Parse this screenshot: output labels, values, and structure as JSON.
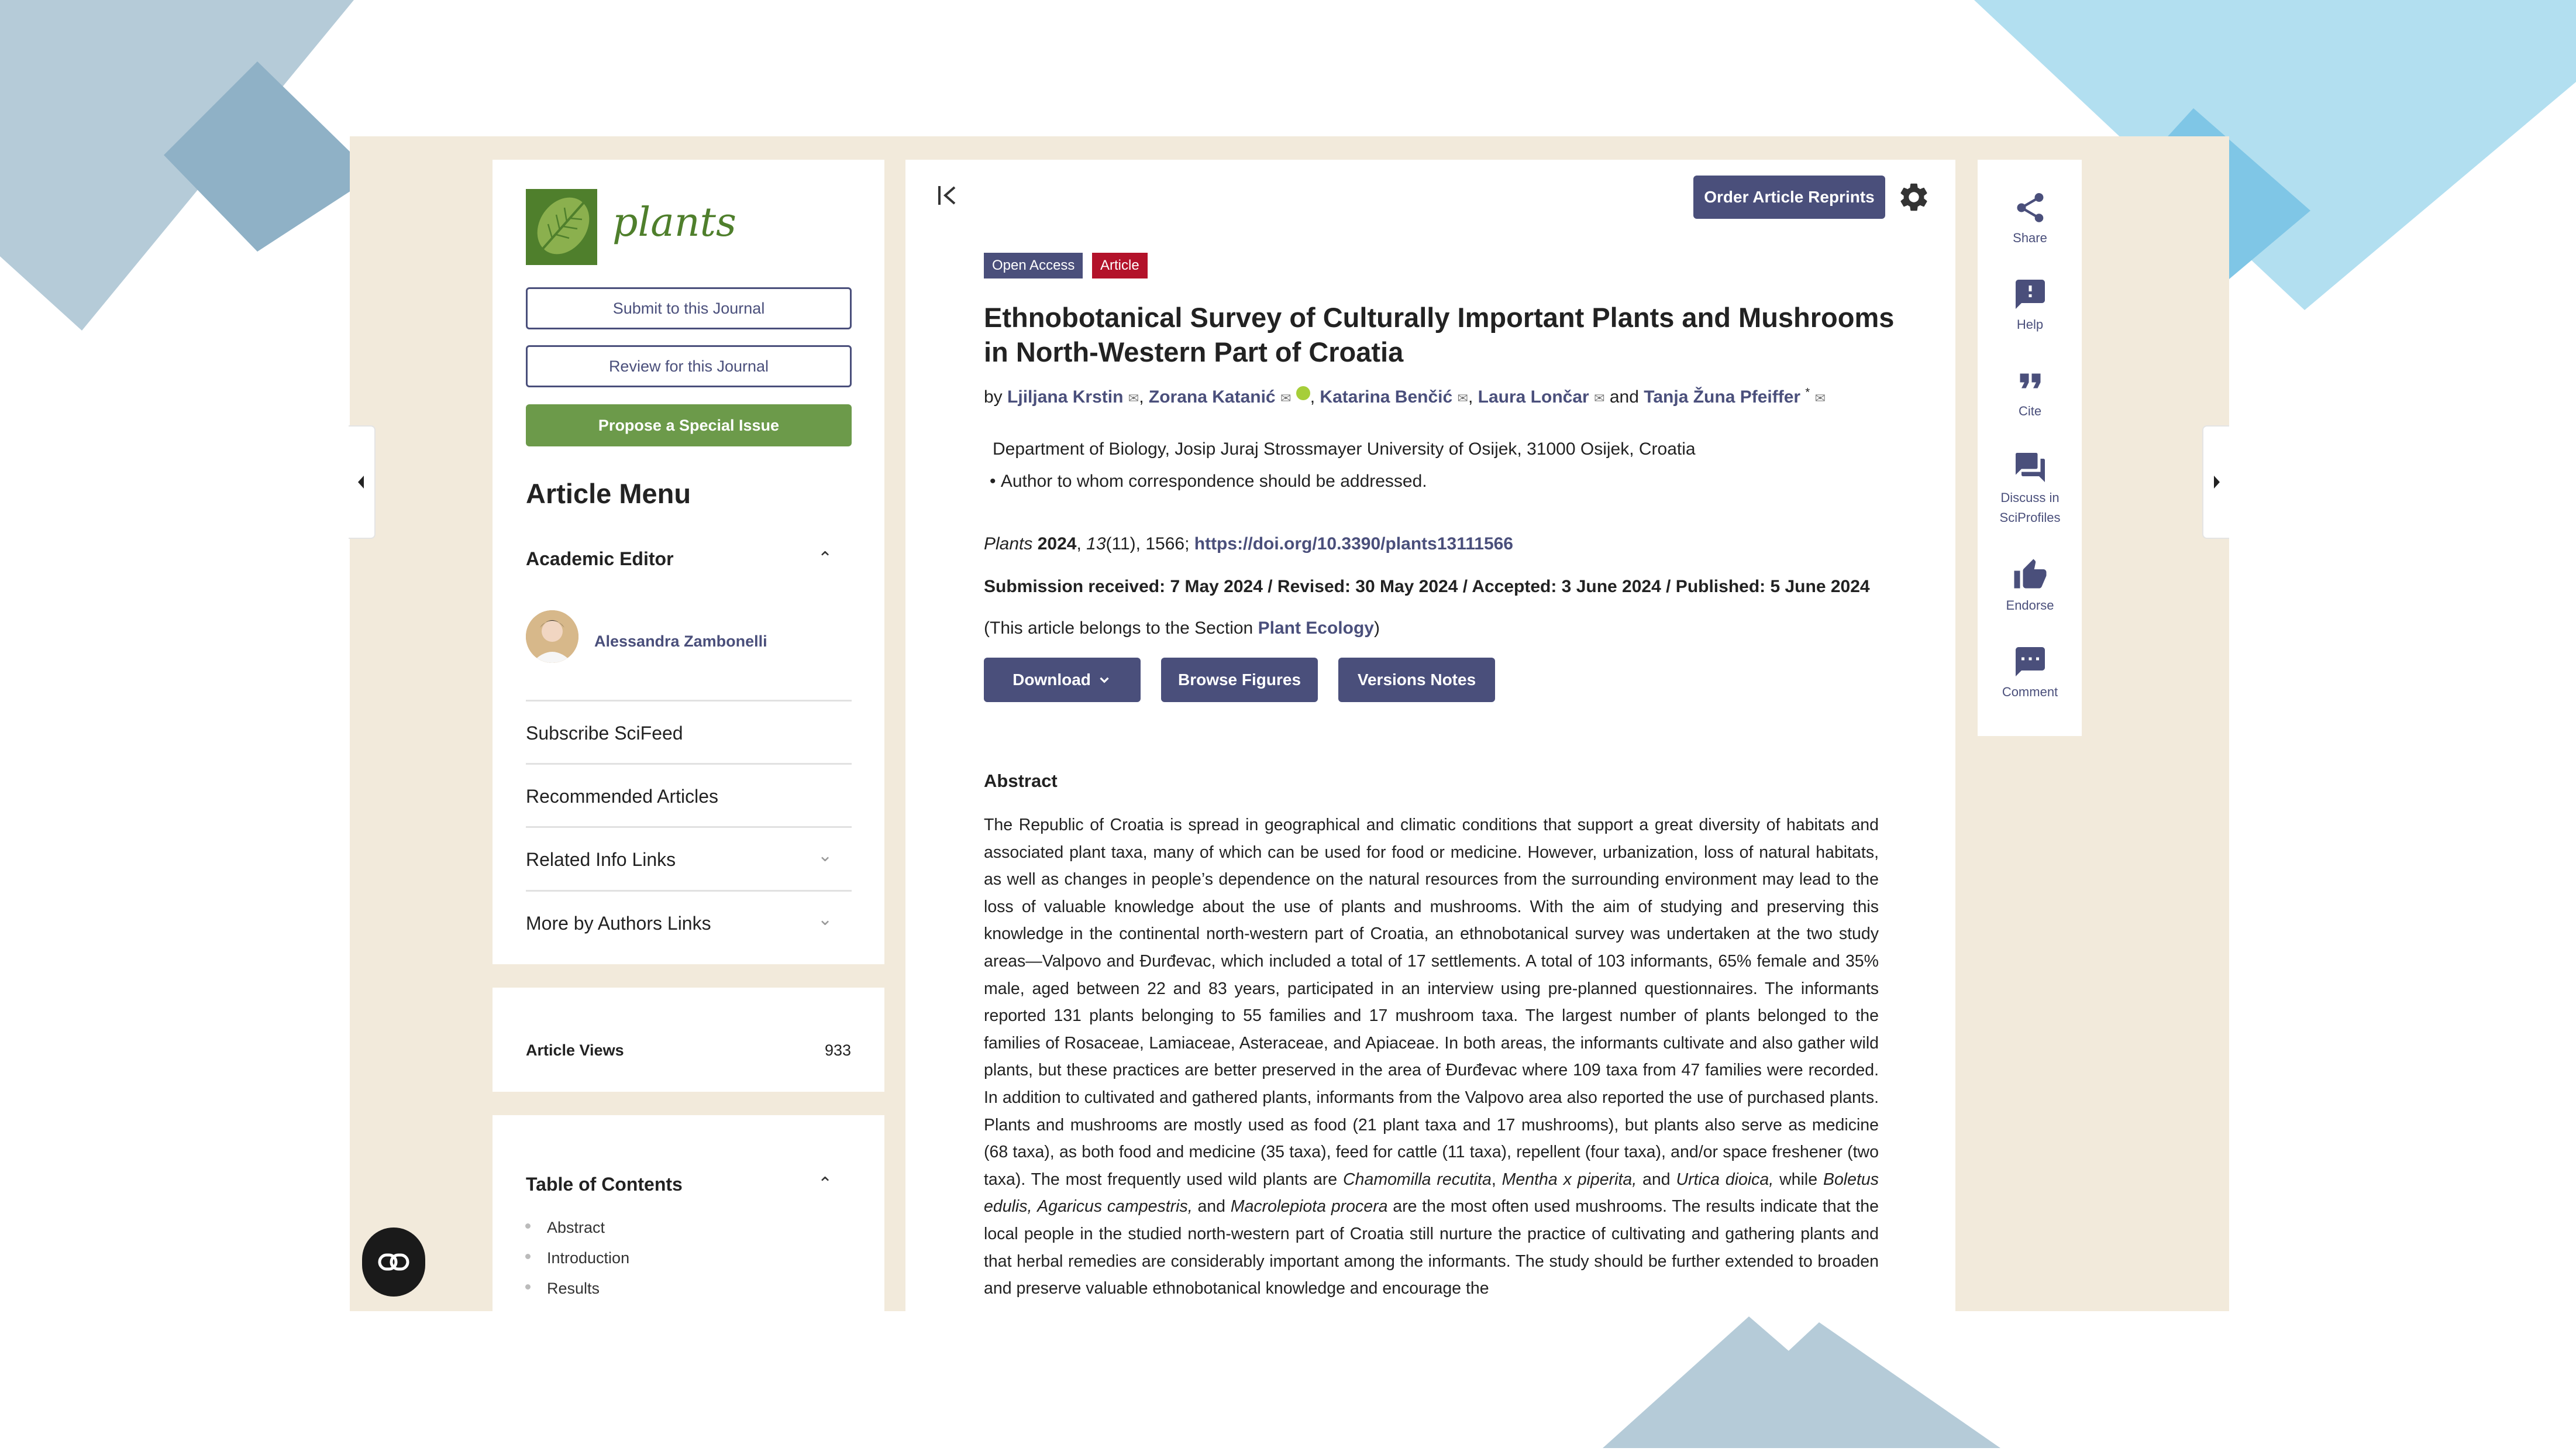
{
  "journal": {
    "name": "plants"
  },
  "sidebar": {
    "submit_label": "Submit to this Journal",
    "review_label": "Review for this Journal",
    "propose_label": "Propose a Special Issue",
    "menu_title": "Article Menu",
    "academic_editor_title": "Academic Editor",
    "editor_name": "Alessandra Zambonelli",
    "items": [
      {
        "label": "Subscribe SciFeed"
      },
      {
        "label": "Recommended Articles"
      },
      {
        "label": "Related Info Links"
      },
      {
        "label": "More by Authors Links"
      }
    ],
    "article_views_label": "Article Views",
    "article_views_count": "933",
    "toc_title": "Table of Contents",
    "toc_items": [
      "Abstract",
      "Introduction",
      "Results"
    ]
  },
  "toolbar": {
    "order_reprints_label": "Order Article Reprints"
  },
  "article": {
    "badge_open_access": "Open Access",
    "badge_article": "Article",
    "title_line1": "Ethnobotanical Survey of Culturally Important Plants and Mushrooms",
    "title_line2": "in North-Western Part of Croatia",
    "by": "by",
    "authors": [
      "Ljiljana Krstin",
      "Zorana Katanić",
      "Katarina Benčić",
      "Laura Lončar",
      "Tanja Žuna Pfeiffer"
    ],
    "author_sep": ",",
    "and": "and",
    "asterisk": "*",
    "affiliation": "Department of Biology, Josip Juraj Strossmayer University of Osijek, 31000 Osijek, Croatia",
    "correspondence": "Author to whom correspondence should be addressed.",
    "citation_journal": "Plants",
    "citation_year": "2024",
    "citation_volume": "13",
    "citation_rest": "(11), 1566;",
    "doi": "https://doi.org/10.3390/plants13111566",
    "dates": "Submission received: 7 May 2024 / Revised: 30 May 2024 / Accepted: 3 June 2024 / Published: 5 June 2024",
    "section_prefix": "(This article belongs to the Section",
    "section_name": "Plant Ecology",
    "section_suffix": ")",
    "download_label": "Download",
    "browse_figures_label": "Browse Figures",
    "versions_notes_label": "Versions Notes",
    "abstract_heading": "Abstract",
    "abstract_part1": "The Republic of Croatia is spread in geographical and climatic conditions that support a great diversity of habitats and associated plant taxa, many of which can be used for food or medicine. However, urbanization, loss of natural habitats, as well as changes in people’s dependence on the natural resources from the surrounding environment may lead to the loss of valuable knowledge about the use of plants and mushrooms. With the aim of studying and preserving this knowledge in the continental north-western part of Croatia, an ethnobotanical survey was undertaken at the two study areas—Valpovo and Đurđevac, which included a total of 17 settlements. A total of 103 informants, 65% female and 35% male, aged between 22 and 83 years, participated in an interview using pre-planned questionnaires. The informants reported 131 plants belonging to 55 families and 17 mushroom taxa. The largest number of plants belonged to the families of Rosaceae, Lamiaceae, Asteraceae, and Apiaceae. In both areas, the informants cultivate and also gather wild plants, but these practices are better preserved in the area of Đurđevac where 109 taxa from 47 families were recorded. In addition to cultivated and gathered plants, informants from the Valpovo area also reported the use of purchased plants. Plants and mushrooms are mostly used as food (21 plant taxa and 17 mushrooms), but plants also serve as medicine (68 taxa), as both food and medicine (35 taxa), feed for cattle (11 taxa), repellent (four taxa), and/or space freshener (two taxa). The most frequently used wild plants are",
    "species_1": "Chamomilla recutita",
    "species_2": "Mentha x piperita,",
    "conj_and": "and",
    "species_3": "Urtica dioica,",
    "conj_while": "while",
    "species_4": "Boletus edulis,",
    "species_5": "Agaricus campestris,",
    "species_6": "Macrolepiota procera",
    "abstract_part2": "are the most often used mushrooms. The results indicate that the local people in the studied north-western part of Croatia still nurture the practice of cultivating and gathering plants and that herbal remedies are considerably important among the informants. The study should be further extended to broaden and preserve valuable ethnobotanical knowledge and encourage the"
  },
  "actions": [
    {
      "label": "Share",
      "icon": "share-icon"
    },
    {
      "label": "Help",
      "icon": "help-icon"
    },
    {
      "label": "Cite",
      "icon": "quote-icon"
    },
    {
      "label": "Discuss in SciProfiles",
      "icon": "chat-icon"
    },
    {
      "label": "Endorse",
      "icon": "thumbs-up-icon"
    },
    {
      "label": "Comment",
      "icon": "comment-icon"
    }
  ],
  "colors": {
    "accent": "#4a4f7b",
    "brand_green": "#6c9a4a",
    "badge_red": "#b3122a",
    "frame_bg": "#f2eadb"
  }
}
